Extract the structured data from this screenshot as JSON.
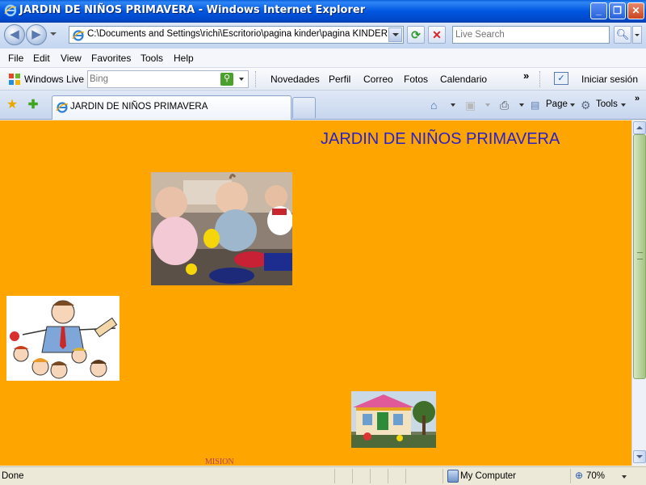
{
  "window": {
    "title": "JARDIN DE NIÑOS PRIMAVERA - Windows Internet Explorer",
    "minimize": "_",
    "maximize": "❐",
    "close": "✕"
  },
  "address_bar": {
    "url": "C:\\Documents and Settings\\richi\\Escritorio\\pagina kinder\\pagina KINDER NUEVA",
    "search_placeholder": "Live Search"
  },
  "menu": {
    "items": [
      "File",
      "Edit",
      "View",
      "Favorites",
      "Tools",
      "Help"
    ]
  },
  "live_toolbar": {
    "brand": "Windows Live",
    "search_placeholder": "Bing",
    "links": [
      "Novedades",
      "Perfil",
      "Correo",
      "Fotos",
      "Calendario"
    ],
    "more": "»",
    "signin": "Iniciar sesión"
  },
  "tabs": {
    "active_tab": "JARDIN DE NIÑOS PRIMAVERA",
    "page_menu": "Page",
    "tools_menu": "Tools"
  },
  "page": {
    "background": "#ffa500",
    "title": "JARDIN DE NIÑOS PRIMAVERA",
    "title_color": "#2a22c8",
    "mision": "MISION"
  },
  "status": {
    "text": "Done",
    "zone": "My Computer",
    "zoom": "70%"
  }
}
